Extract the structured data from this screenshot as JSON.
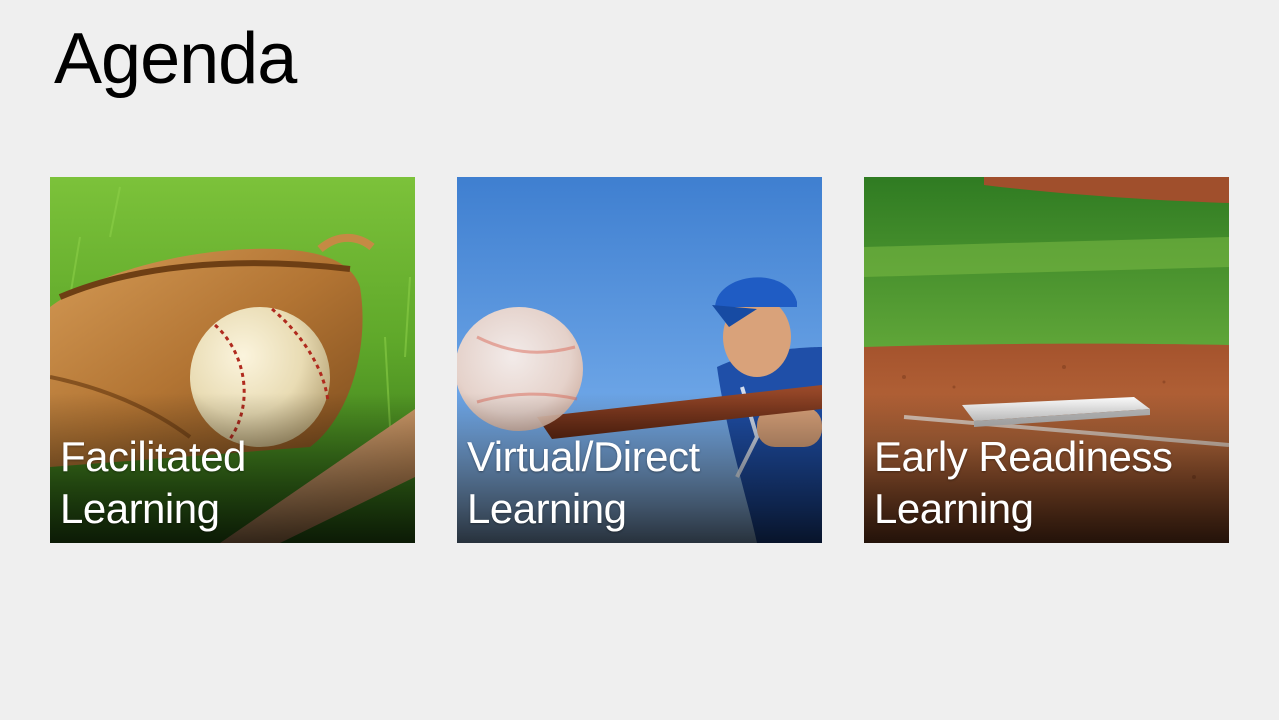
{
  "slide": {
    "title": "Agenda"
  },
  "tiles": [
    {
      "image": "baseball-in-glove-on-grass",
      "line1": "Facilitated",
      "line2": "Learning"
    },
    {
      "image": "batter-swinging-at-ball",
      "line1": "Virtual/Direct",
      "line2": "Learning"
    },
    {
      "image": "base-on-infield-dirt",
      "line1": "Early Readiness",
      "line2": "Learning"
    }
  ]
}
